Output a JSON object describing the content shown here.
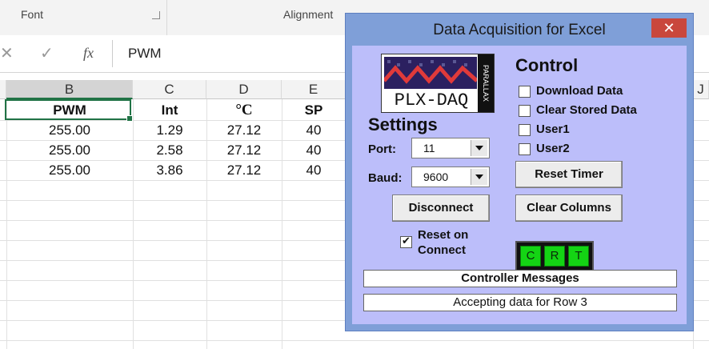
{
  "ribbon": {
    "groups": [
      "Font",
      "Alignment"
    ]
  },
  "formula_bar": {
    "content": "PWM",
    "fx": "fx",
    "cancel": "✕",
    "enter": "✓"
  },
  "columns": [
    "B",
    "C",
    "D",
    "E",
    "J"
  ],
  "sheet": {
    "headers": [
      "PWM",
      "Int",
      "°C",
      "SP"
    ],
    "rows": [
      [
        "255.00",
        "1.29",
        "27.12",
        "40"
      ],
      [
        "255.00",
        "2.58",
        "27.12",
        "40"
      ],
      [
        "255.00",
        "3.86",
        "27.12",
        "40"
      ]
    ]
  },
  "dialog": {
    "title": "Data Acquisition for Excel",
    "close_label": "✕",
    "logo_text": "PLX-DAQ",
    "logo_side": "PARALLAX",
    "settings_heading": "Settings",
    "port_label": "Port:",
    "port_value": "11",
    "baud_label": "Baud:",
    "baud_value": "9600",
    "disconnect_label": "Disconnect",
    "reset_on_connect_line1": "Reset on",
    "reset_on_connect_line2": "Connect",
    "reset_on_connect_checked": true,
    "control_heading": "Control",
    "checkboxes": [
      {
        "label": "Download Data",
        "checked": false
      },
      {
        "label": "Clear Stored Data",
        "checked": false
      },
      {
        "label": "User1",
        "checked": false
      },
      {
        "label": "User2",
        "checked": false
      }
    ],
    "reset_timer_label": "Reset Timer",
    "clear_columns_label": "Clear Columns",
    "crt_leds": [
      "C",
      "R",
      "T"
    ],
    "controller_messages_label": "Controller Messages",
    "status_message": "Accepting data for Row 3"
  }
}
